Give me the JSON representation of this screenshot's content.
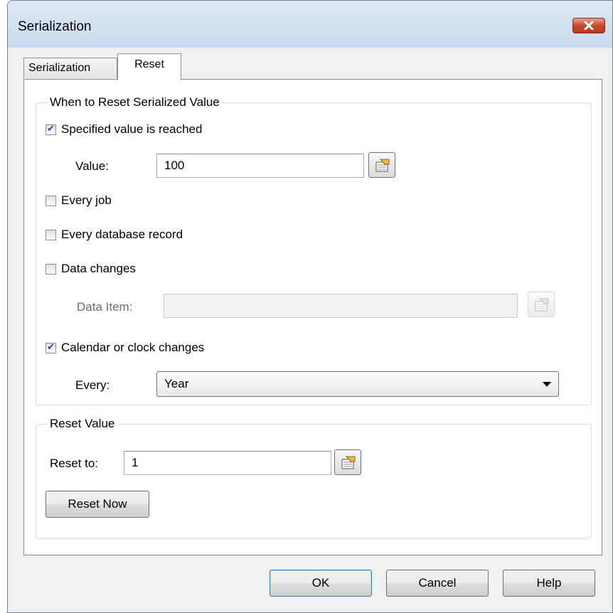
{
  "window": {
    "title": "Serialization"
  },
  "tabs": [
    {
      "label": "Serialization"
    },
    {
      "label": "Reset"
    }
  ],
  "when_group": {
    "legend": "When to Reset Serialized Value",
    "specified_value": {
      "label": "Specified value is reached",
      "checked": true
    },
    "value": {
      "label": "Value:",
      "value": "100"
    },
    "every_job": {
      "label": "Every job",
      "checked": false
    },
    "every_db_record": {
      "label": "Every database record",
      "checked": false
    },
    "data_changes": {
      "label": "Data changes",
      "checked": false
    },
    "data_item": {
      "label": "Data Item:",
      "value": ""
    },
    "calendar_changes": {
      "label": "Calendar or clock changes",
      "checked": true
    },
    "every": {
      "label": "Every:",
      "selected": "Year"
    }
  },
  "reset_group": {
    "legend": "Reset Value",
    "reset_to": {
      "label": "Reset to:",
      "value": "1"
    },
    "reset_now_label": "Reset Now"
  },
  "buttons": {
    "ok": "OK",
    "cancel": "Cancel",
    "help": "Help"
  },
  "icons": {
    "close": "close-icon",
    "browse": "data-source-icon",
    "dropdown": "chevron-down-icon"
  }
}
